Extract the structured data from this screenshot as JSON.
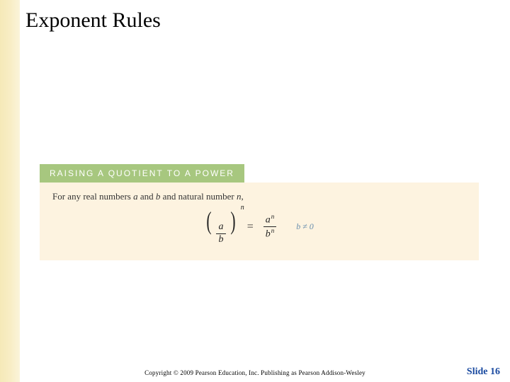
{
  "slide": {
    "title": "Exponent Rules",
    "rule": {
      "header_prefix": "RAISING A QUOTIENT",
      "header_suffix": " TO A POWER",
      "intro_pre": "For any real numbers ",
      "intro_a": "a",
      "intro_and": " and ",
      "intro_b": "b",
      "intro_mid": " and natural number ",
      "intro_n": "n",
      "intro_post": ",",
      "lhs_num": "a",
      "lhs_den": "b",
      "lhs_exp": "n",
      "eq": "=",
      "rhs_num_base": "a",
      "rhs_num_exp": "n",
      "rhs_den_base": "b",
      "rhs_den_exp": "n",
      "condition": "b ≠ 0"
    },
    "copyright": "Copyright © 2009 Pearson Education, Inc.  Publishing as Pearson Addison-Wesley",
    "slide_number": "Slide 16"
  }
}
